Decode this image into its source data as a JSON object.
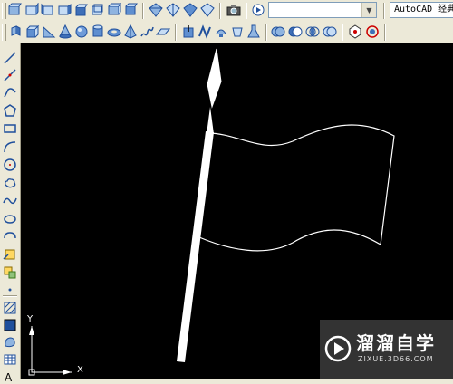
{
  "toolbar_top": {
    "workspace_label": "AutoCAD 经典",
    "layer_value": ""
  },
  "canvas": {
    "background": "#000000",
    "ucs": {
      "y_label": "Y",
      "x_label": "X"
    }
  },
  "watermark": {
    "logo": "play-circle-logo",
    "title": "溜溜自学",
    "url": "ZIXUE.3D66.COM"
  }
}
